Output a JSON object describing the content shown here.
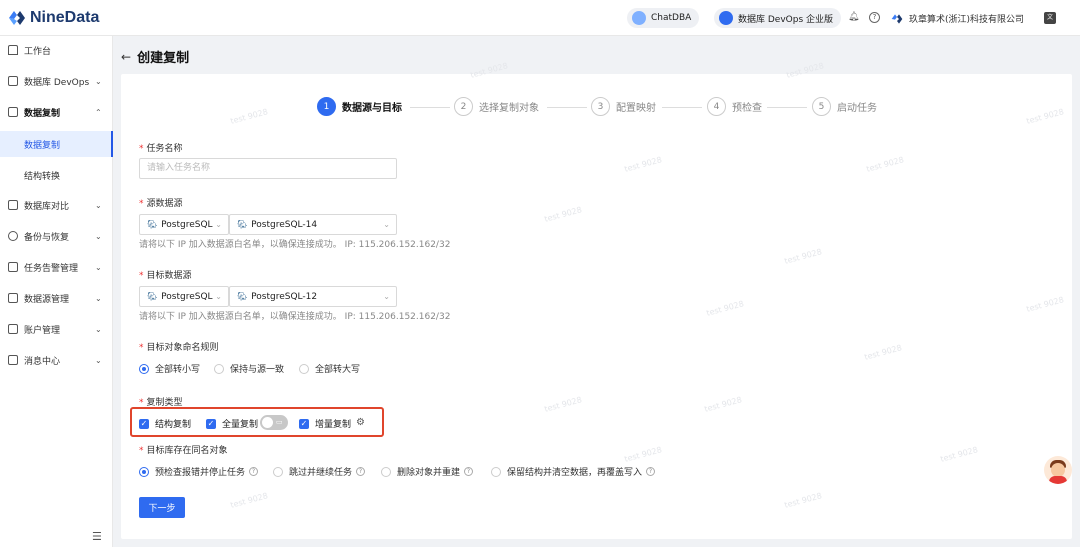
{
  "app": {
    "logo_text": "NineData"
  },
  "header": {
    "chatdba_label": "ChatDBA",
    "edition_label": "数据库 DevOps 企业版",
    "company": "玖章算术(浙江)科技有限公司"
  },
  "sidebar": {
    "items": [
      {
        "label": "工作台"
      },
      {
        "label": "数据库 DevOps"
      },
      {
        "label": "数据复制"
      },
      {
        "label": "数据复制"
      },
      {
        "label": "结构转换"
      },
      {
        "label": "数据库对比"
      },
      {
        "label": "备份与恢复"
      },
      {
        "label": "任务告警管理"
      },
      {
        "label": "数据源管理"
      },
      {
        "label": "账户管理"
      },
      {
        "label": "消息中心"
      }
    ]
  },
  "page": {
    "title": "创建复制"
  },
  "steps": [
    {
      "num": "1",
      "label": "数据源与目标"
    },
    {
      "num": "2",
      "label": "选择复制对象"
    },
    {
      "num": "3",
      "label": "配置映射"
    },
    {
      "num": "4",
      "label": "预检查"
    },
    {
      "num": "5",
      "label": "启动任务"
    }
  ],
  "form": {
    "task_name": {
      "label": "任务名称",
      "placeholder": "请输入任务名称"
    },
    "source": {
      "label": "源数据源",
      "type": "PostgreSQL",
      "instance": "PostgreSQL-14",
      "hint": "请将以下 IP 加入数据源白名单，以确保连接成功。 IP: 115.206.152.162/32"
    },
    "target": {
      "label": "目标数据源",
      "type": "PostgreSQL",
      "instance": "PostgreSQL-12",
      "hint": "请将以下 IP 加入数据源白名单，以确保连接成功。 IP: 115.206.152.162/32"
    },
    "naming": {
      "label": "目标对象命名规则",
      "options": [
        "全部转小写",
        "保持与源一致",
        "全部转大写"
      ],
      "selected": 0
    },
    "copy_type": {
      "label": "复制类型",
      "options": [
        "结构复制",
        "全量复制",
        "增量复制"
      ],
      "full_toggle_on": false
    },
    "conflict": {
      "label": "目标库存在同名对象",
      "options": [
        "预检查报错并停止任务",
        "跳过并继续任务",
        "删除对象并重建",
        "保留结构并清空数据，再覆盖写入"
      ],
      "selected": 0
    },
    "next_label": "下一步"
  },
  "watermark_text": "test 9028",
  "colors": {
    "primary": "#2f6bf0",
    "highlight": "#e0452c"
  }
}
